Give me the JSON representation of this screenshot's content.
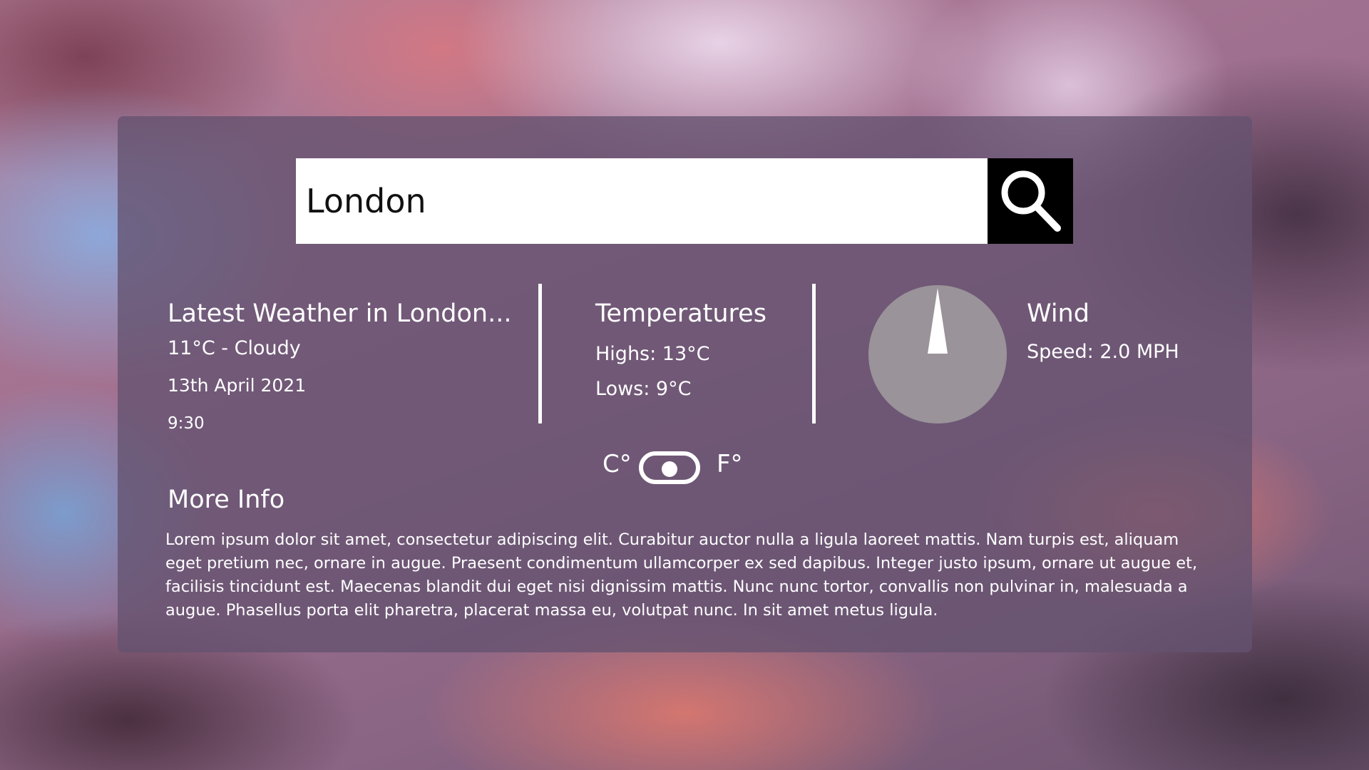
{
  "search": {
    "value": "London",
    "icon": "search-icon"
  },
  "latest": {
    "title": "Latest Weather in London...",
    "condition": "11°C - Cloudy",
    "date": "13th April 2021",
    "time": "9:30"
  },
  "temperatures": {
    "title": "Temperatures",
    "highs": "Highs: 13°C",
    "lows": "Lows:  9°C"
  },
  "wind": {
    "title": "Wind",
    "speed": "Speed: 2.0 MPH",
    "direction_icon": "compass-needle-icon"
  },
  "units": {
    "celsius_label": "C°",
    "fahrenheit_label": "F°"
  },
  "more_info": {
    "title": "More Info",
    "body": "Lorem ipsum dolor sit amet, consectetur adipiscing elit. Curabitur auctor nulla a ligula laoreet mattis. Nam turpis est, aliquam eget pretium nec, ornare in augue. Praesent condimentum ullamcorper ex sed dapibus. Integer justo ipsum, ornare ut augue et, facilisis tincidunt est. Maecenas blandit dui eget nisi dignissim mattis. Nunc nunc tortor, convallis non pulvinar in, malesuada a augue. Phasellus porta elit pharetra, placerat massa eu, volutpat nunc. In sit amet metus ligula."
  },
  "colors": {
    "panel": "#645270",
    "search_button": "#000000",
    "text": "#ffffff",
    "compass": "#9a9399"
  }
}
